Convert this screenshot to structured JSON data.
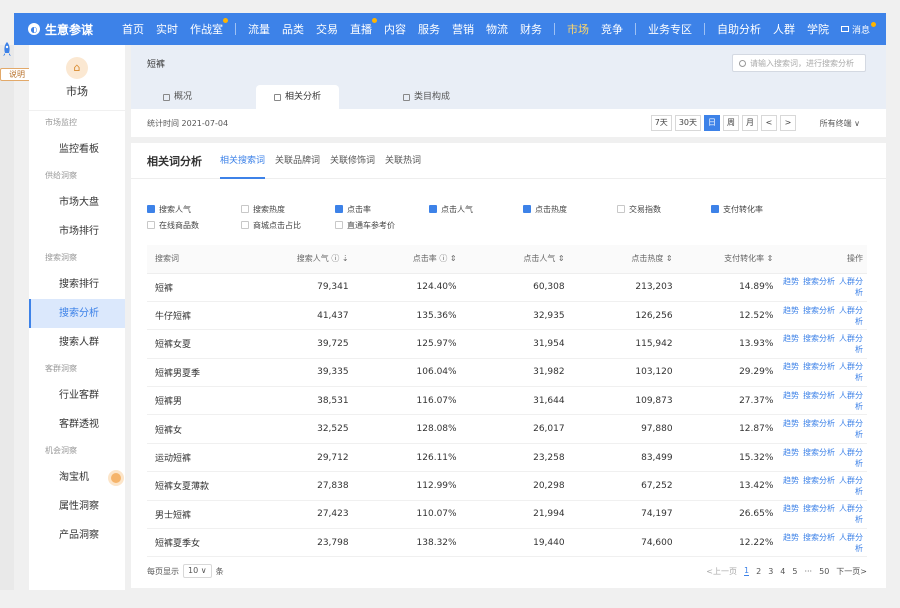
{
  "topnav": {
    "logo": "生意参谋",
    "items": [
      "首页",
      "实时",
      "作战室",
      "流量",
      "品类",
      "交易",
      "直播",
      "内容",
      "服务",
      "营销",
      "物流",
      "财务",
      "市场",
      "竞争",
      "业务专区",
      "自助分析",
      "人群",
      "学院"
    ],
    "active": "市场",
    "msg": "消息"
  },
  "edge": {
    "note": "说明"
  },
  "sidebar": {
    "head": "市场",
    "groups": [
      {
        "title": "市场监控",
        "items": [
          "监控看板"
        ]
      },
      {
        "title": "供给洞察",
        "items": [
          "市场大盘",
          "市场排行"
        ]
      },
      {
        "title": "搜索洞察",
        "items": [
          "搜索排行",
          "搜索分析",
          "搜索人群"
        ]
      },
      {
        "title": "客群洞察",
        "items": [
          "行业客群",
          "客群透视"
        ]
      },
      {
        "title": "机会洞察",
        "items": [
          "淘宝机",
          "属性洞察",
          "产品洞察"
        ]
      }
    ],
    "active": "搜索分析"
  },
  "main": {
    "title": "短裤",
    "search_placeholder": "请输入搜索词，进行搜索分析",
    "tabs": [
      "概况",
      "相关分析",
      "类目构成"
    ],
    "active_tab": "相关分析",
    "date": "统计时间 2021-07-04",
    "ranges": [
      "7天",
      "30天",
      "日",
      "周",
      "月",
      "<",
      ">"
    ],
    "active_range": "日",
    "terminal": "所有终端 ∨"
  },
  "section": {
    "title": "相关词分析",
    "tabs": [
      "相关搜索词",
      "关联品牌词",
      "关联修饰词",
      "关联热词"
    ],
    "active_tab": "相关搜索词"
  },
  "checks": {
    "row1": [
      {
        "label": "搜索人气",
        "on": true
      },
      {
        "label": "搜索热度",
        "on": false
      },
      {
        "label": "点击率",
        "on": true
      },
      {
        "label": "点击人气",
        "on": true
      },
      {
        "label": "点击热度",
        "on": true
      },
      {
        "label": "交易指数",
        "on": false
      },
      {
        "label": "支付转化率",
        "on": true
      }
    ],
    "row2": [
      {
        "label": "在线商品数",
        "on": false
      },
      {
        "label": "商城点击占比",
        "on": false
      },
      {
        "label": "直通车参考价",
        "on": false
      }
    ]
  },
  "table": {
    "headers": [
      "搜索词",
      "搜索人气 ⓘ ⇣",
      "点击率 ⓘ ⇕",
      "点击人气 ⇕",
      "点击热度 ⇕",
      "支付转化率 ⇕",
      "操作"
    ],
    "rows": [
      [
        "短裤",
        "79,341",
        "124.40%",
        "60,308",
        "213,203",
        "14.89%"
      ],
      [
        "牛仔短裤",
        "41,437",
        "135.36%",
        "32,935",
        "126,256",
        "12.52%"
      ],
      [
        "短裤女夏",
        "39,725",
        "125.97%",
        "31,954",
        "115,942",
        "13.93%"
      ],
      [
        "短裤男夏季",
        "39,335",
        "106.04%",
        "31,982",
        "103,120",
        "29.29%"
      ],
      [
        "短裤男",
        "38,531",
        "116.07%",
        "31,644",
        "109,873",
        "27.37%"
      ],
      [
        "短裤女",
        "32,525",
        "128.08%",
        "26,017",
        "97,880",
        "12.87%"
      ],
      [
        "运动短裤",
        "29,712",
        "126.11%",
        "23,258",
        "83,499",
        "15.32%"
      ],
      [
        "短裤女夏薄款",
        "27,838",
        "112.99%",
        "20,298",
        "67,252",
        "13.42%"
      ],
      [
        "男士短裤",
        "27,423",
        "110.07%",
        "21,994",
        "74,197",
        "26.65%"
      ],
      [
        "短裤夏季女",
        "23,798",
        "138.32%",
        "19,440",
        "74,600",
        "12.22%"
      ]
    ],
    "ops": [
      "趋势",
      "搜索分析",
      "人群分析"
    ]
  },
  "pager": {
    "prefix": "每页显示",
    "size": "10 ∨",
    "suffix": "条",
    "prev": "<上一页",
    "pages": [
      "1",
      "2",
      "3",
      "4",
      "5",
      "···",
      "50"
    ],
    "next": "下一页>",
    "current": "1"
  }
}
